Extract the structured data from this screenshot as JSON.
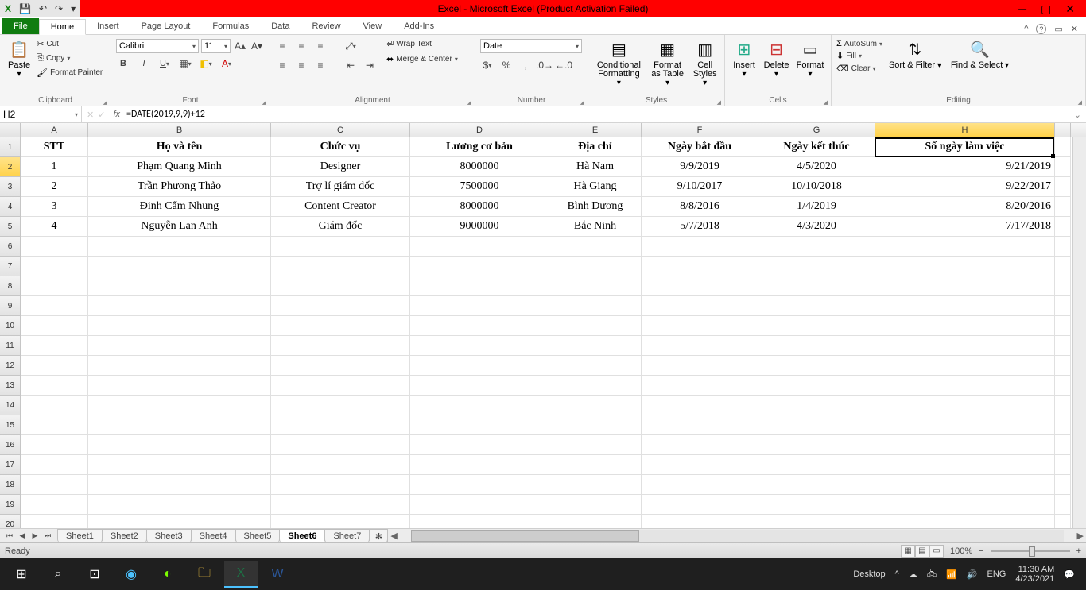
{
  "titlebar": {
    "title": "Excel  -  Microsoft Excel (Product Activation Failed)"
  },
  "qat": {
    "save": "💾",
    "undo": "↶",
    "redo": "↷"
  },
  "tabs": {
    "file": "File",
    "home": "Home",
    "insert": "Insert",
    "page_layout": "Page Layout",
    "formulas": "Formulas",
    "data": "Data",
    "review": "Review",
    "view": "View",
    "addins": "Add-Ins"
  },
  "ribbon": {
    "clipboard": {
      "paste": "Paste",
      "cut": "Cut",
      "copy": "Copy",
      "format_painter": "Format Painter",
      "label": "Clipboard"
    },
    "font": {
      "name": "Calibri",
      "size": "11",
      "label": "Font"
    },
    "alignment": {
      "wrap": "Wrap Text",
      "merge": "Merge & Center",
      "label": "Alignment"
    },
    "number": {
      "format": "Date",
      "label": "Number"
    },
    "styles": {
      "cond": "Conditional Formatting",
      "table": "Format as Table",
      "cell": "Cell Styles",
      "label": "Styles"
    },
    "cells": {
      "insert": "Insert",
      "delete": "Delete",
      "format": "Format",
      "label": "Cells"
    },
    "editing": {
      "autosum": "AutoSum",
      "fill": "Fill",
      "clear": "Clear",
      "sort": "Sort & Filter",
      "find": "Find & Select",
      "label": "Editing"
    }
  },
  "namebox": {
    "ref": "H2"
  },
  "formula": "=DATE(2019,9,9)+12",
  "columns": [
    "A",
    "B",
    "C",
    "D",
    "E",
    "F",
    "G",
    "H"
  ],
  "headers": {
    "A": "STT",
    "B": "Họ và tên",
    "C": "Chức vụ",
    "D": "Lương cơ bản",
    "E": "Địa chỉ",
    "F": "Ngày bắt đầu",
    "G": "Ngày kết thúc",
    "H": "Số ngày làm việc"
  },
  "rows": [
    {
      "A": "1",
      "B": "Phạm Quang Minh",
      "C": "Designer",
      "D": "8000000",
      "E": "Hà Nam",
      "F": "9/9/2019",
      "G": "4/5/2020",
      "H": "9/21/2019"
    },
    {
      "A": "2",
      "B": "Trần Phương Thảo",
      "C": "Trợ lí giám đốc",
      "D": "7500000",
      "E": "Hà Giang",
      "F": "9/10/2017",
      "G": "10/10/2018",
      "H": "9/22/2017"
    },
    {
      "A": "3",
      "B": "Đinh Cẩm Nhung",
      "C": "Content Creator",
      "D": "8000000",
      "E": "Bình Dương",
      "F": "8/8/2016",
      "G": "1/4/2019",
      "H": "8/20/2016"
    },
    {
      "A": "4",
      "B": "Nguyễn Lan Anh",
      "C": "Giám đốc",
      "D": "9000000",
      "E": "Bắc Ninh",
      "F": "5/7/2018",
      "G": "4/3/2020",
      "H": "7/17/2018"
    }
  ],
  "sheets": [
    "Sheet1",
    "Sheet2",
    "Sheet3",
    "Sheet4",
    "Sheet5",
    "Sheet6",
    "Sheet7"
  ],
  "active_sheet": "Sheet6",
  "status": {
    "ready": "Ready",
    "zoom": "100%"
  },
  "taskbar": {
    "desktop": "Desktop",
    "lang": "ENG",
    "time": "11:30 AM",
    "date": "4/23/2021"
  }
}
